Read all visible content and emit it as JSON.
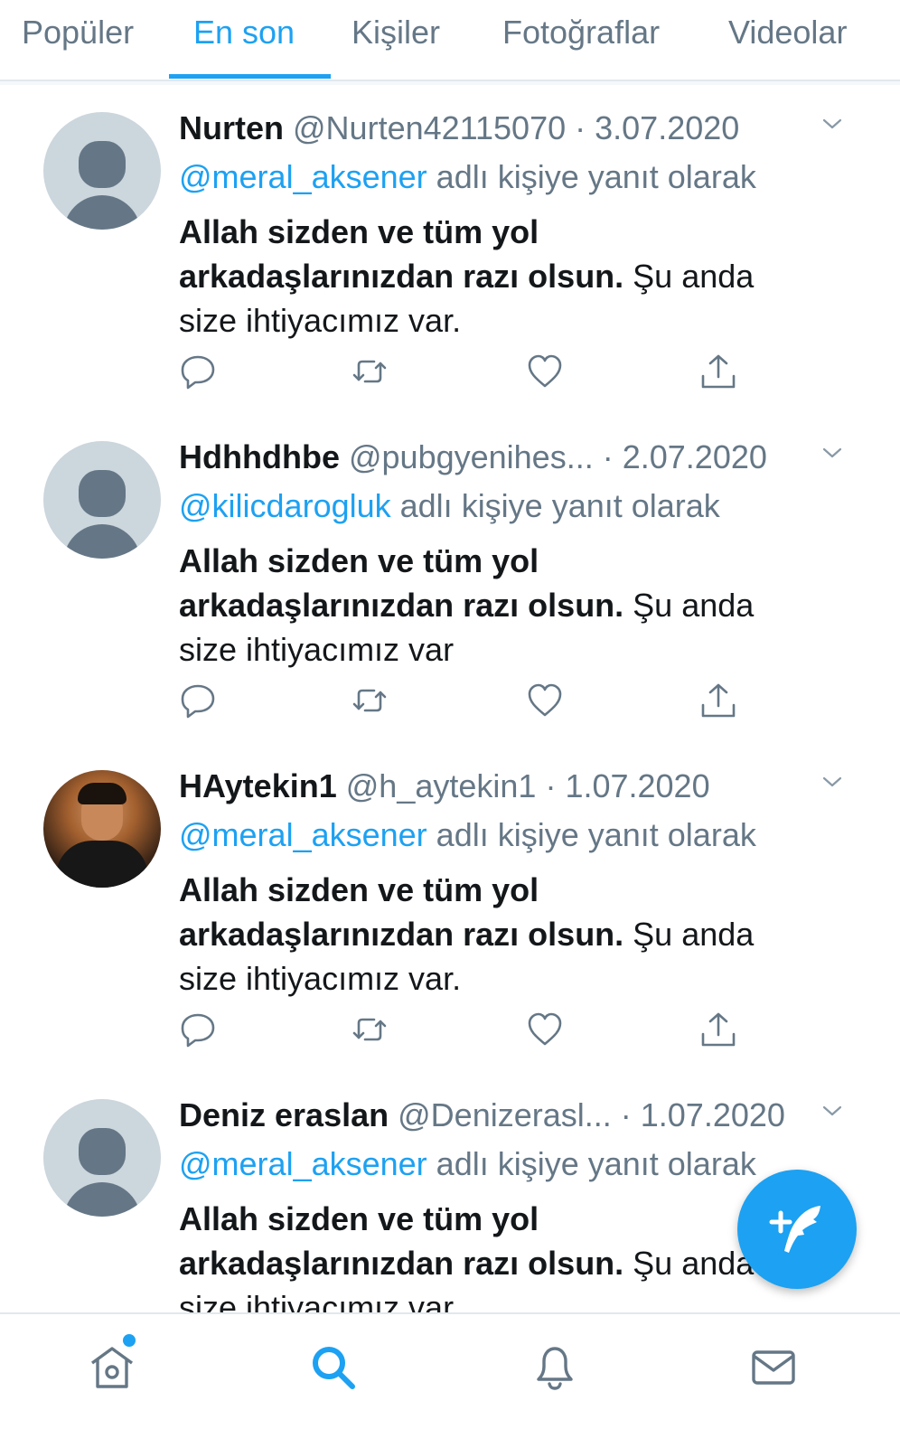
{
  "tabs": [
    {
      "label": "Popüler"
    },
    {
      "label": "En son"
    },
    {
      "label": "Kişiler"
    },
    {
      "label": "Fotoğraflar"
    },
    {
      "label": "Videolar"
    }
  ],
  "tweets": [
    {
      "name": "Nurten",
      "handle": "@Nurten42115070",
      "date": "· 3.07.2020",
      "reply_mention": "@meral_aksener",
      "reply_suffix": " adlı kişiye yanıt olarak",
      "text_bold": "Allah sizden ve tüm yol arkadaşlarınızdan razı olsun.",
      "text_rest": " Şu anda size ihtiyacımız var.",
      "avatar": "default-avatar"
    },
    {
      "name": "Hdhhdhbe",
      "handle": "@pubgyenihes...",
      "date": "· 2.07.2020",
      "reply_mention": "@kilicdarogluk",
      "reply_suffix": " adlı kişiye yanıt olarak",
      "text_bold": "Allah sizden ve tüm yol arkadaşlarınızdan razı olsun.",
      "text_rest": " Şu anda size ihtiyacımız var",
      "avatar": "default-avatar"
    },
    {
      "name": "HAytekin1",
      "handle": "@h_aytekin1",
      "date": "· 1.07.2020",
      "reply_mention": "@meral_aksener",
      "reply_suffix": " adlı kişiye yanıt olarak",
      "text_bold": "Allah sizden ve tüm yol arkadaşlarınızdan razı olsun.",
      "text_rest": " Şu anda size ihtiyacımız var.",
      "avatar": "photo-avatar"
    },
    {
      "name": "Deniz eraslan",
      "handle": "@Denizerasl...",
      "date": "· 1.07.2020",
      "reply_mention": "@meral_aksener",
      "reply_suffix": " adlı kişiye yanıt olarak",
      "text_bold": "Allah sizden ve tüm yol arkadaşlarınızdan razı olsun.",
      "text_rest": " Şu anda size ihtiyacımız var.",
      "avatar": "default-avatar"
    }
  ],
  "icons": {
    "reply": "reply-icon",
    "retweet": "retweet-icon",
    "like": "heart-icon",
    "share": "share-icon",
    "compose": "compose-tweet-icon",
    "home": "home-icon",
    "search": "search-icon",
    "notifications": "bell-icon",
    "messages": "mail-icon"
  },
  "colors": {
    "accent": "#1da1f2",
    "muted": "#657786",
    "text": "#14171a"
  }
}
